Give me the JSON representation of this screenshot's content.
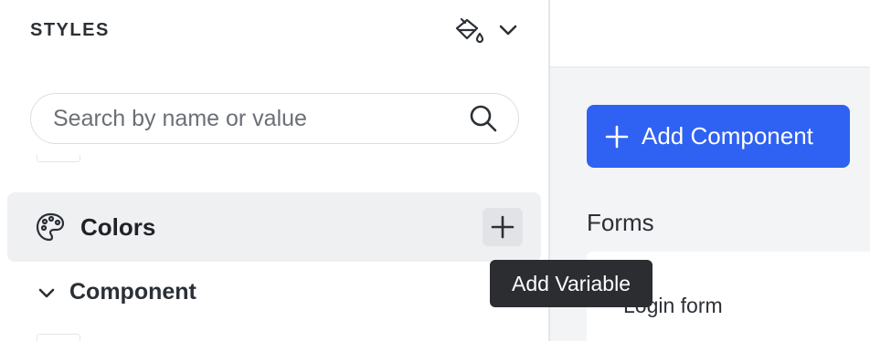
{
  "sidebar": {
    "title": "STYLES",
    "theme_icon": "paint-bucket-icon",
    "theme_menu_icon": "chevron-down-icon",
    "search": {
      "placeholder": "Search by name or value",
      "value": "",
      "icon": "search-icon"
    },
    "sections": [
      {
        "label": "Colors",
        "icon": "palette-icon",
        "action_icon": "plus-icon",
        "active": true
      },
      {
        "label": "Component",
        "icon": "chevron-down-icon",
        "expanded": true
      }
    ]
  },
  "tooltip": {
    "text": "Add Variable"
  },
  "canvas": {
    "add_component_label": "Add Component",
    "add_component_icon": "plus-icon",
    "groups": [
      {
        "title": "Forms",
        "items": [
          {
            "label": "Login form"
          }
        ]
      }
    ]
  },
  "colors": {
    "accent": "#2f62f2",
    "tooltip_bg": "#2b2d31",
    "row_active": "#eff0f2"
  }
}
